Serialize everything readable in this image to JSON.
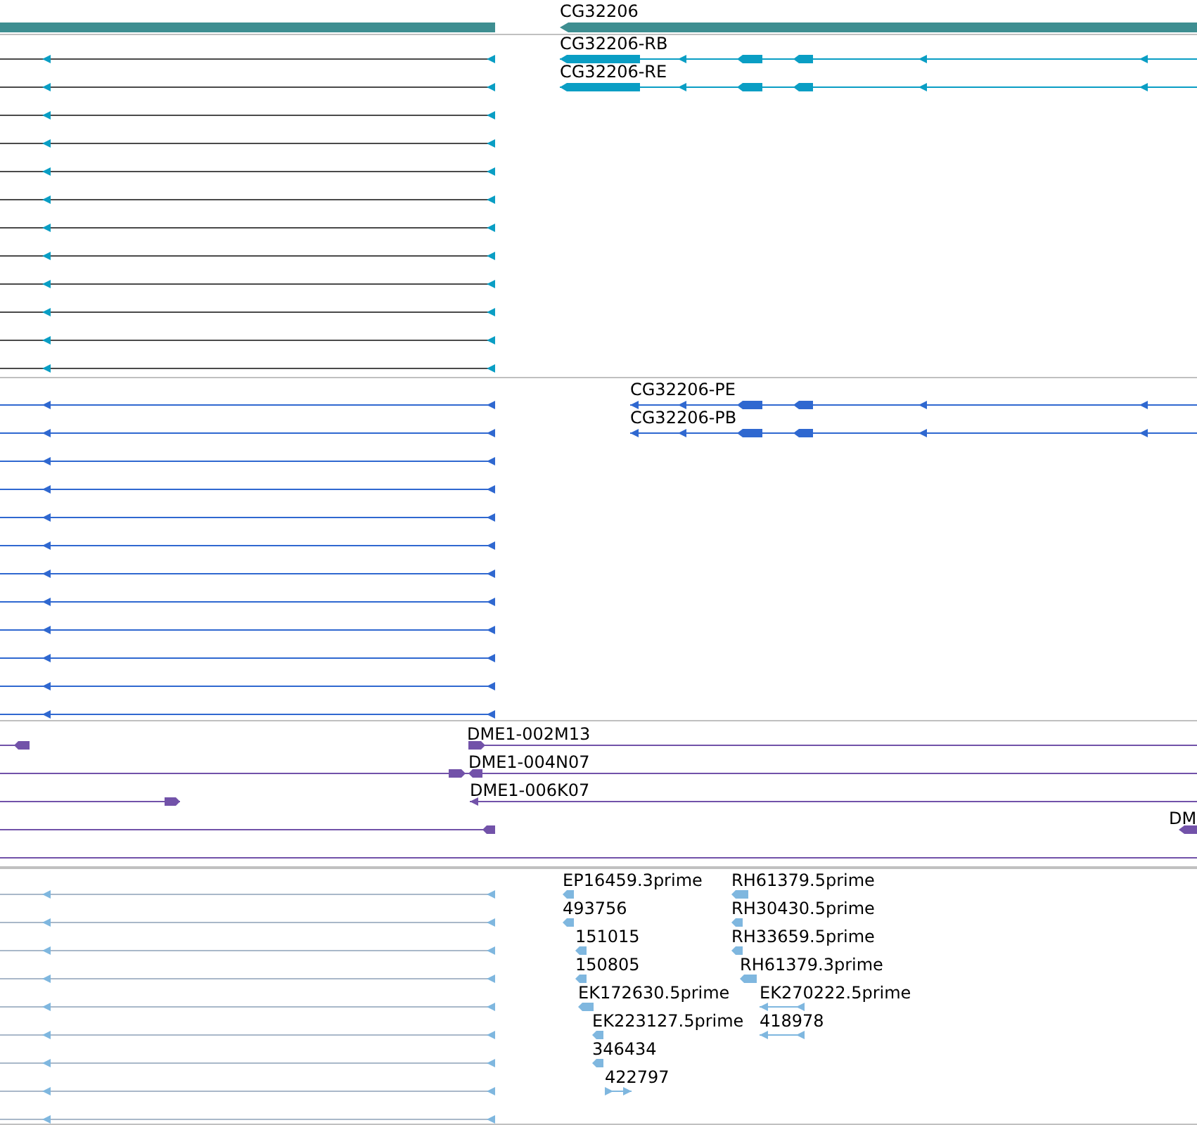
{
  "tracks": [
    {
      "kind": "gene",
      "labels": [
        "CG32206"
      ]
    },
    {
      "kind": "transcript",
      "labels": [
        "CG32206-RB",
        "CG32206-RE"
      ]
    },
    {
      "kind": "protein",
      "labels": [
        "CG32206-PE",
        "CG32206-PB"
      ]
    },
    {
      "kind": "clone",
      "labels": [
        "DME1-002M13",
        "DME1-004N07",
        "DME1-006K07",
        "DM"
      ]
    },
    {
      "kind": "est",
      "labels": [
        "EP16459.3prime",
        "RH61379.5prime",
        "493756",
        "RH30430.5prime",
        "151015",
        "RH33659.5prime",
        "150805",
        "RH61379.3prime",
        "EK172630.5prime",
        "EK270222.5prime",
        "EK223127.5prime",
        "418978",
        "346434",
        "422797"
      ]
    }
  ]
}
